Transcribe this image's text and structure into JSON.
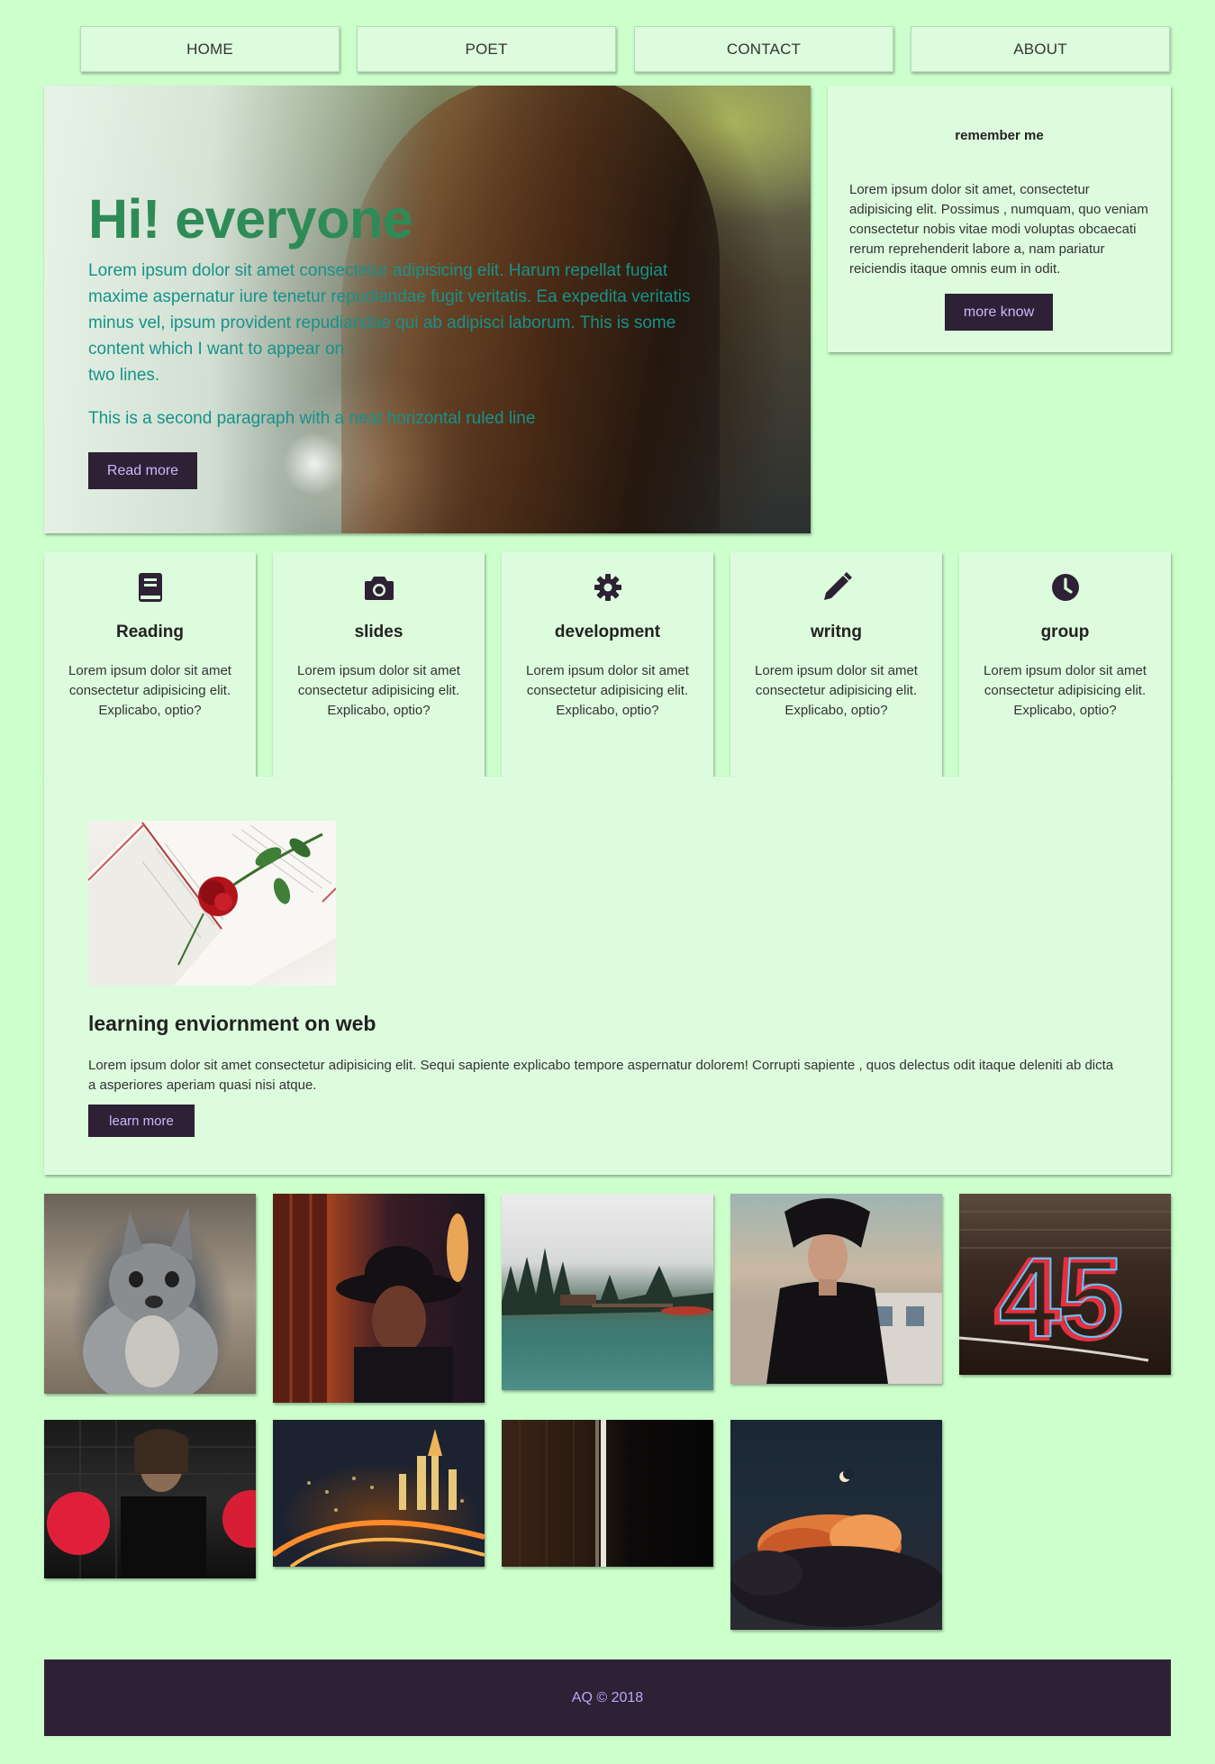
{
  "nav": {
    "items": [
      {
        "label": "HOME"
      },
      {
        "label": "POET"
      },
      {
        "label": "CONTACT"
      },
      {
        "label": "ABOUT"
      }
    ]
  },
  "hero": {
    "title": "Hi! everyone",
    "paragraph1_line1": "Lorem ipsum dolor sit amet consectetur adipisicing elit. Harum repellat fugiat",
    "paragraph1_line2": "maxime aspernatur iure tenetur repudiandae fugit veritatis. Ea expedita veritatis",
    "paragraph1_line3": "minus vel, ipsum provident repudiandae qui ab adipisci laborum. This is some",
    "paragraph1_line4": "content which I want to appear on",
    "paragraph1_line5": "two lines.",
    "paragraph2": "This is a second paragraph with a neat horizontal ruled line",
    "button_label": "Read more"
  },
  "remember": {
    "title": "remember me",
    "text": "Lorem ipsum dolor sit amet, consectetur adipisicing elit. Possimus , numquam, quo veniam consectetur nobis vitae modi voluptas obcaecati rerum reprehenderit labore a, nam pariatur reiciendis itaque omnis eum in odit.",
    "button_label": "more know"
  },
  "features": [
    {
      "title": "Reading",
      "icon": "book-icon",
      "text": "Lorem ipsum dolor sit amet consectetur adipisicing elit. Explicabo, optio?"
    },
    {
      "title": "slides",
      "icon": "camera-icon",
      "text": "Lorem ipsum dolor sit amet consectetur adipisicing elit. Explicabo, optio?"
    },
    {
      "title": "development",
      "icon": "gear-icon",
      "text": "Lorem ipsum dolor sit amet consectetur adipisicing elit. Explicabo, optio?"
    },
    {
      "title": "writng",
      "icon": "pencil-icon",
      "text": "Lorem ipsum dolor sit amet consectetur adipisicing elit. Explicabo, optio?"
    },
    {
      "title": "group",
      "icon": "clock-icon",
      "text": "Lorem ipsum dolor sit amet consectetur adipisicing elit. Explicabo, optio?"
    }
  ],
  "learning": {
    "title": "learning enviornment on web",
    "text": "Lorem ipsum dolor sit amet consectetur adipisicing elit. Sequi sapiente explicabo tempore aspernatur dolorem! Corrupti sapiente , quos delectus odit itaque deleniti ab dicta a asperiores aperiam quasi nisi atque.",
    "button_label": "learn more"
  },
  "gallery": {
    "neon_text": "45"
  },
  "footer": {
    "text": "AQ © 2018"
  },
  "colors": {
    "background": "#ccffcc",
    "card": "#ddfcdd",
    "dark": "#2e2135",
    "accent_text": "#c9b8ff",
    "hero_title": "#2e8b57",
    "hero_text": "#16928a"
  }
}
